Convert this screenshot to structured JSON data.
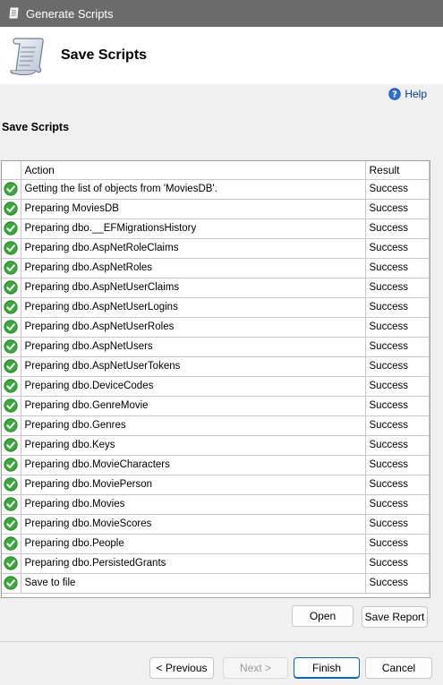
{
  "window": {
    "title": "Generate Scripts"
  },
  "header": {
    "title": "Save Scripts"
  },
  "help": {
    "label": "Help"
  },
  "section": {
    "title": "Save Scripts"
  },
  "grid": {
    "columns": {
      "action": "Action",
      "result": "Result"
    },
    "rows": [
      {
        "action": "Getting the list of objects from 'MoviesDB'.",
        "result": "Success"
      },
      {
        "action": "Preparing MoviesDB",
        "result": "Success"
      },
      {
        "action": "Preparing dbo.__EFMigrationsHistory",
        "result": "Success"
      },
      {
        "action": "Preparing dbo.AspNetRoleClaims",
        "result": "Success"
      },
      {
        "action": "Preparing dbo.AspNetRoles",
        "result": "Success"
      },
      {
        "action": "Preparing dbo.AspNetUserClaims",
        "result": "Success"
      },
      {
        "action": "Preparing dbo.AspNetUserLogins",
        "result": "Success"
      },
      {
        "action": "Preparing dbo.AspNetUserRoles",
        "result": "Success"
      },
      {
        "action": "Preparing dbo.AspNetUsers",
        "result": "Success"
      },
      {
        "action": "Preparing dbo.AspNetUserTokens",
        "result": "Success"
      },
      {
        "action": "Preparing dbo.DeviceCodes",
        "result": "Success"
      },
      {
        "action": "Preparing dbo.GenreMovie",
        "result": "Success"
      },
      {
        "action": "Preparing dbo.Genres",
        "result": "Success"
      },
      {
        "action": "Preparing dbo.Keys",
        "result": "Success"
      },
      {
        "action": "Preparing dbo.MovieCharacters",
        "result": "Success"
      },
      {
        "action": "Preparing dbo.MoviePerson",
        "result": "Success"
      },
      {
        "action": "Preparing dbo.Movies",
        "result": "Success"
      },
      {
        "action": "Preparing dbo.MovieScores",
        "result": "Success"
      },
      {
        "action": "Preparing dbo.People",
        "result": "Success"
      },
      {
        "action": "Preparing dbo.PersistedGrants",
        "result": "Success"
      },
      {
        "action": "Save to file",
        "result": "Success"
      }
    ],
    "status_icon": "success-check-icon"
  },
  "buttons": {
    "open": "Open",
    "save_report": "Save Report",
    "previous": "< Previous",
    "next": "Next >",
    "finish": "Finish",
    "cancel": "Cancel"
  },
  "colors": {
    "titlebar": "#6b6b6b",
    "success_green": "#2e9e2e",
    "help_blue": "#0a3d8f"
  }
}
